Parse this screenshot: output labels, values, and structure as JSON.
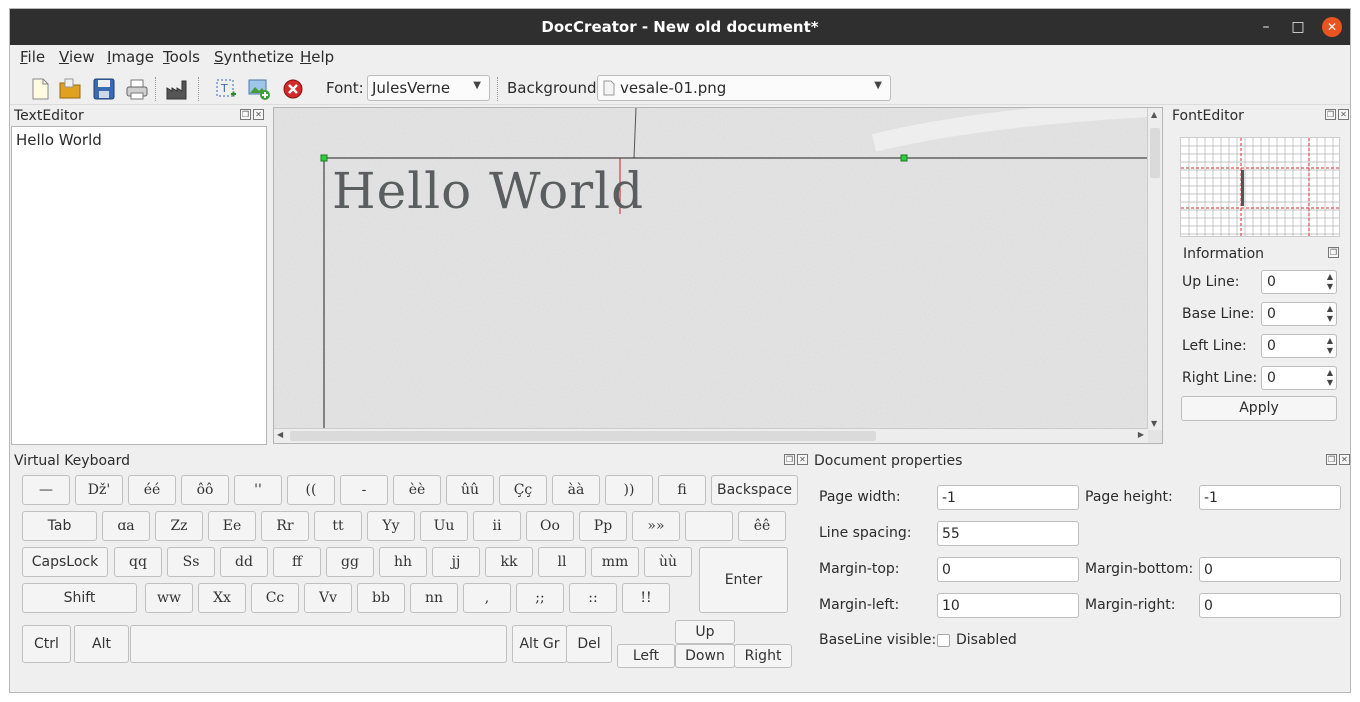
{
  "window": {
    "title": "DocCreator - New old document*"
  },
  "menu": [
    "File",
    "View",
    "Image",
    "Tools",
    "Synthetize",
    "Help"
  ],
  "toolbar": {
    "font_label": "Font:",
    "font_value": "JulesVerne",
    "background_label": "Background:",
    "background_value": "vesale-01.png"
  },
  "text_editor": {
    "title": "TextEditor",
    "content": "Hello World"
  },
  "canvas": {
    "text": "Hello World"
  },
  "font_editor": {
    "title": "FontEditor",
    "information_title": "Information",
    "fields": [
      {
        "label": "Up Line:",
        "value": "0"
      },
      {
        "label": "Base Line:",
        "value": "0"
      },
      {
        "label": "Left Line:",
        "value": "0"
      },
      {
        "label": "Right Line:",
        "value": "0"
      }
    ],
    "apply_label": "Apply"
  },
  "keyboard": {
    "title": "Virtual Keyboard",
    "rows": [
      [
        "—",
        "ǅ'",
        "éé",
        "ôô",
        "''",
        "((",
        "-",
        "èè",
        "ûû",
        "Çç",
        "àà",
        "))",
        "fi",
        "Backspace"
      ],
      [
        "Tab",
        "ɑa",
        "Zz",
        "Ee",
        "Rr",
        "tt",
        "Yy",
        "Uu",
        "ii",
        "Oo",
        "Pp",
        "»»",
        "",
        "êê"
      ],
      [
        "CapsLock",
        "qq",
        "Ss",
        "dd",
        "ff",
        "gg",
        "hh",
        "jj",
        "kk",
        "ll",
        "mm",
        "ùù",
        "Enter"
      ],
      [
        "Shift",
        "ww",
        "Xx",
        "Cc",
        "Vv",
        "bb",
        "nn",
        ",",
        ";;",
        "::",
        "!!"
      ],
      [
        "Ctrl",
        "Alt",
        "",
        "Alt Gr",
        "Del",
        "Up",
        "Left",
        "Down",
        "Right"
      ]
    ]
  },
  "document_properties": {
    "title": "Document properties",
    "page_width_label": "Page width:",
    "page_width": "-1",
    "page_height_label": "Page height:",
    "page_height": "-1",
    "line_spacing_label": "Line spacing:",
    "line_spacing": "55",
    "margin_top_label": "Margin-top:",
    "margin_top": "0",
    "margin_bottom_label": "Margin-bottom:",
    "margin_bottom": "0",
    "margin_left_label": "Margin-left:",
    "margin_left": "10",
    "margin_right_label": "Margin-right:",
    "margin_right": "0",
    "baseline_label": "BaseLine visible:",
    "baseline_value": "Disabled"
  },
  "colors": {
    "titlebar": "#2f2f2f",
    "close": "#e95420",
    "marker": "#2ecc40",
    "cursor": "#cc2222"
  }
}
